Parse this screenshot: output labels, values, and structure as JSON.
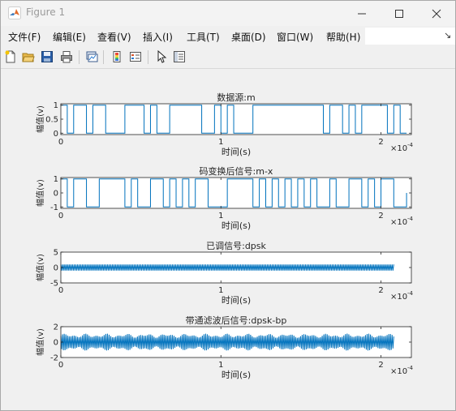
{
  "window": {
    "title": "Figure 1"
  },
  "menu": [
    {
      "label": "文件(F)"
    },
    {
      "label": "编辑(E)"
    },
    {
      "label": "查看(V)"
    },
    {
      "label": "插入(I)"
    },
    {
      "label": "工具(T)"
    },
    {
      "label": "桌面(D)"
    },
    {
      "label": "窗口(W)"
    },
    {
      "label": "帮助(H)"
    }
  ],
  "toolbar": {
    "icons": [
      "new-figure-icon",
      "open-file-icon",
      "save-icon",
      "print-icon",
      "link-plot-icon",
      "insert-colorbar-icon",
      "insert-legend-icon",
      "edit-plot-pointer-icon",
      "property-inspector-icon"
    ]
  },
  "chart_data": [
    {
      "type": "line",
      "title": "数据源:m",
      "xlabel": "时间(s)",
      "ylabel": "幅值(v)",
      "xlim": [
        0,
        0.000219
      ],
      "ylim": [
        -0.05,
        1.05
      ],
      "xticks": [
        "0",
        "1",
        "2"
      ],
      "yticks": [
        "0",
        "0.5",
        "1"
      ],
      "x_exponent": "×10",
      "x_exponent_power": "-4",
      "bit_period": 4e-06,
      "bits": [
        1,
        0,
        1,
        1,
        0,
        1,
        1,
        0,
        0,
        0,
        1,
        1,
        1,
        0,
        1,
        0,
        0,
        1,
        1,
        1,
        1,
        1,
        0,
        0,
        1,
        0,
        1,
        0,
        0,
        0,
        1,
        1,
        1,
        1,
        1,
        1,
        1,
        1,
        1,
        1,
        1,
        0,
        1,
        1,
        0,
        1,
        0,
        1,
        1,
        1,
        1,
        0,
        1,
        0
      ],
      "color": "#0072bd"
    },
    {
      "type": "line",
      "title": "码变换后信号:m-x",
      "xlabel": "时间(s)",
      "ylabel": "幅值(v)",
      "xlim": [
        0,
        0.000219
      ],
      "ylim": [
        -1.1,
        1.1
      ],
      "xticks": [
        "0",
        "1",
        "2"
      ],
      "yticks": [
        "-1",
        "0",
        "1"
      ],
      "x_exponent": "×10",
      "x_exponent_power": "-4",
      "bit_period": 4e-06,
      "bits": [
        1,
        -1,
        1,
        1,
        -1,
        -1,
        1,
        1,
        1,
        1,
        -1,
        1,
        -1,
        -1,
        1,
        1,
        -1,
        1,
        -1,
        1,
        -1,
        1,
        1,
        -1,
        -1,
        -1,
        1,
        1,
        1,
        1,
        -1,
        1,
        -1,
        1,
        -1,
        1,
        -1,
        1,
        -1,
        1,
        -1,
        -1,
        1,
        -1,
        -1,
        1,
        1,
        -1,
        1,
        -1,
        1,
        1,
        -1,
        -1
      ],
      "color": "#0072bd"
    },
    {
      "type": "line",
      "title": "已调信号:dpsk",
      "xlabel": "时间(s)",
      "ylabel": "幅值(v)",
      "xlim": [
        0,
        0.000219
      ],
      "ylim": [
        -5,
        5
      ],
      "xticks": [
        "0",
        "1",
        "2"
      ],
      "yticks": [
        "-5",
        "0",
        "5"
      ],
      "x_exponent": "×10",
      "x_exponent_power": "-4",
      "duration": 0.000208,
      "amplitude": 1,
      "cycles": 200,
      "color": "#0072bd"
    },
    {
      "type": "line",
      "title": "带通滤波后信号:dpsk-bp",
      "xlabel": "时间(s)",
      "ylabel": "幅值(v)",
      "xlim": [
        0,
        0.000219
      ],
      "ylim": [
        -2,
        2
      ],
      "xticks": [
        "0",
        "1",
        "2"
      ],
      "yticks": [
        "-2",
        "0",
        "2"
      ],
      "x_exponent": "×10",
      "x_exponent_power": "-4",
      "duration": 0.000208,
      "amplitude": 1.1,
      "cycles": 200,
      "color": "#0072bd"
    }
  ]
}
